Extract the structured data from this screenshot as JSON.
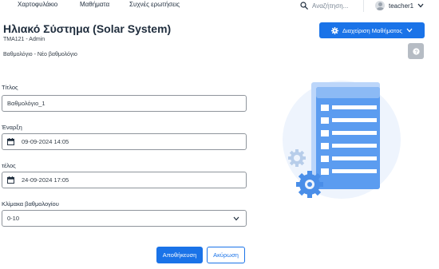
{
  "nav": {
    "links": [
      "Χαρτοφυλάκιο",
      "Μαθήματα",
      "Συχνές ερωτήσεις"
    ],
    "search_placeholder": "Αναζήτηση...",
    "user_name": "teacher1"
  },
  "header": {
    "title": "Ηλιακό Σύστημα (Solar System)",
    "course_meta": "TMA121 - Admin",
    "breadcrumb": "Βαθμολόγιο - Νέο βαθμολόγιο",
    "manage_button_label": "Διαχείριση Μαθήματος"
  },
  "form": {
    "title_label": "Τίτλος",
    "title_value": "Βαθμολόγιο_1",
    "start_label": "Έναρξη",
    "start_value": "09-09-2024 14:05",
    "end_label": "τέλος",
    "end_value": "24-09-2024 17:05",
    "scale_label": "Κλίμακα βαθμολογίου",
    "scale_value": "0-10",
    "save_label": "Αποθήκευση",
    "cancel_label": "Ακύρωση"
  },
  "colors": {
    "primary": "#1a73e8",
    "help_button": "#b6bcc4",
    "illustration_blue": "#5b9cf0"
  }
}
